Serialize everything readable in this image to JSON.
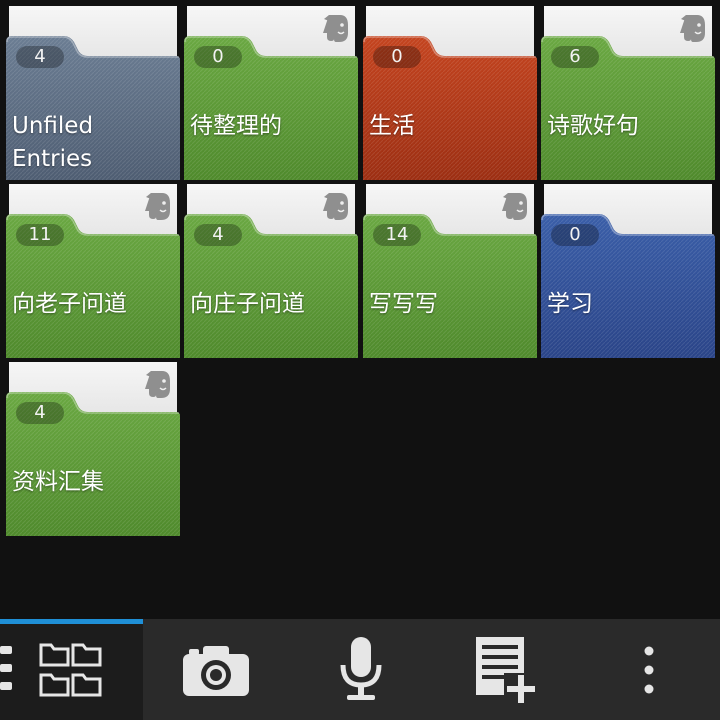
{
  "notebooks": [
    {
      "count": "4",
      "label": "Unfiled Entries",
      "color": "#6b7d93",
      "dark": "#4e5d72",
      "evernote": false
    },
    {
      "count": "0",
      "label": "待整理的",
      "color": "#6aa842",
      "dark": "#4f8a2c",
      "evernote": true
    },
    {
      "count": "0",
      "label": "生活",
      "color": "#c4441f",
      "dark": "#9c2e12",
      "evernote": false
    },
    {
      "count": "6",
      "label": "诗歌好句",
      "color": "#6aa842",
      "dark": "#4f8a2c",
      "evernote": true
    },
    {
      "count": "11",
      "label": "向老子问道",
      "color": "#6aa842",
      "dark": "#4f8a2c",
      "evernote": true
    },
    {
      "count": "4",
      "label": "向庄子问道",
      "color": "#6aa842",
      "dark": "#4f8a2c",
      "evernote": true
    },
    {
      "count": "14",
      "label": "写写写",
      "color": "#6aa842",
      "dark": "#4f8a2c",
      "evernote": true
    },
    {
      "count": "0",
      "label": "学习",
      "color": "#3a5ea8",
      "dark": "#2a4488",
      "evernote": false
    },
    {
      "count": "4",
      "label": "资料汇集",
      "color": "#6aa842",
      "dark": "#4f8a2c",
      "evernote": true
    }
  ],
  "toolbar": {
    "accent": "#1f8fd6",
    "items": [
      "menu-grid-icon",
      "camera-icon",
      "microphone-icon",
      "new-note-icon",
      "overflow-menu-icon"
    ]
  }
}
